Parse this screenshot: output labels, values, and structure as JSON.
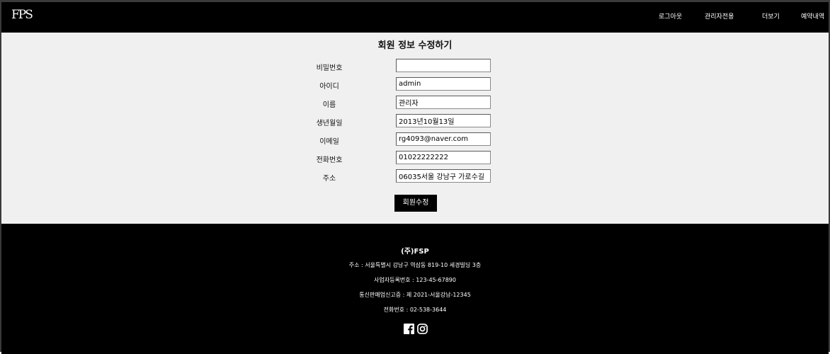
{
  "header": {
    "logo": "FPS",
    "nav": [
      "로그아웃",
      "관리자전용",
      "더보기",
      "예약내역"
    ]
  },
  "main": {
    "title": "회원 정보 수정하기",
    "fields": [
      {
        "label": "비밀번호",
        "value": ""
      },
      {
        "label": "아이디",
        "value": "admin"
      },
      {
        "label": "이름",
        "value": "관리자"
      },
      {
        "label": "생년월일",
        "value": "2013년10월13일"
      },
      {
        "label": "이메일",
        "value": "rg4093@naver.com"
      },
      {
        "label": "전화번호",
        "value": "01022222222"
      },
      {
        "label": "주소",
        "value": "06035서울 강남구 가로수길"
      }
    ],
    "submit_label": "회원수정"
  },
  "footer": {
    "company": "(주)FSP",
    "address": "주소 : 서울특별시 강남구 역삼동 819-10 세경빌딩 3층",
    "business_no": "사업자등록번호 : 123-45-67890",
    "telecom_no": "통신판매업신고증 : 제 2021-서울강남-12345",
    "phone": "전화번호 : 02-538-3644",
    "social_icons": [
      "facebook-icon",
      "instagram-icon"
    ]
  }
}
